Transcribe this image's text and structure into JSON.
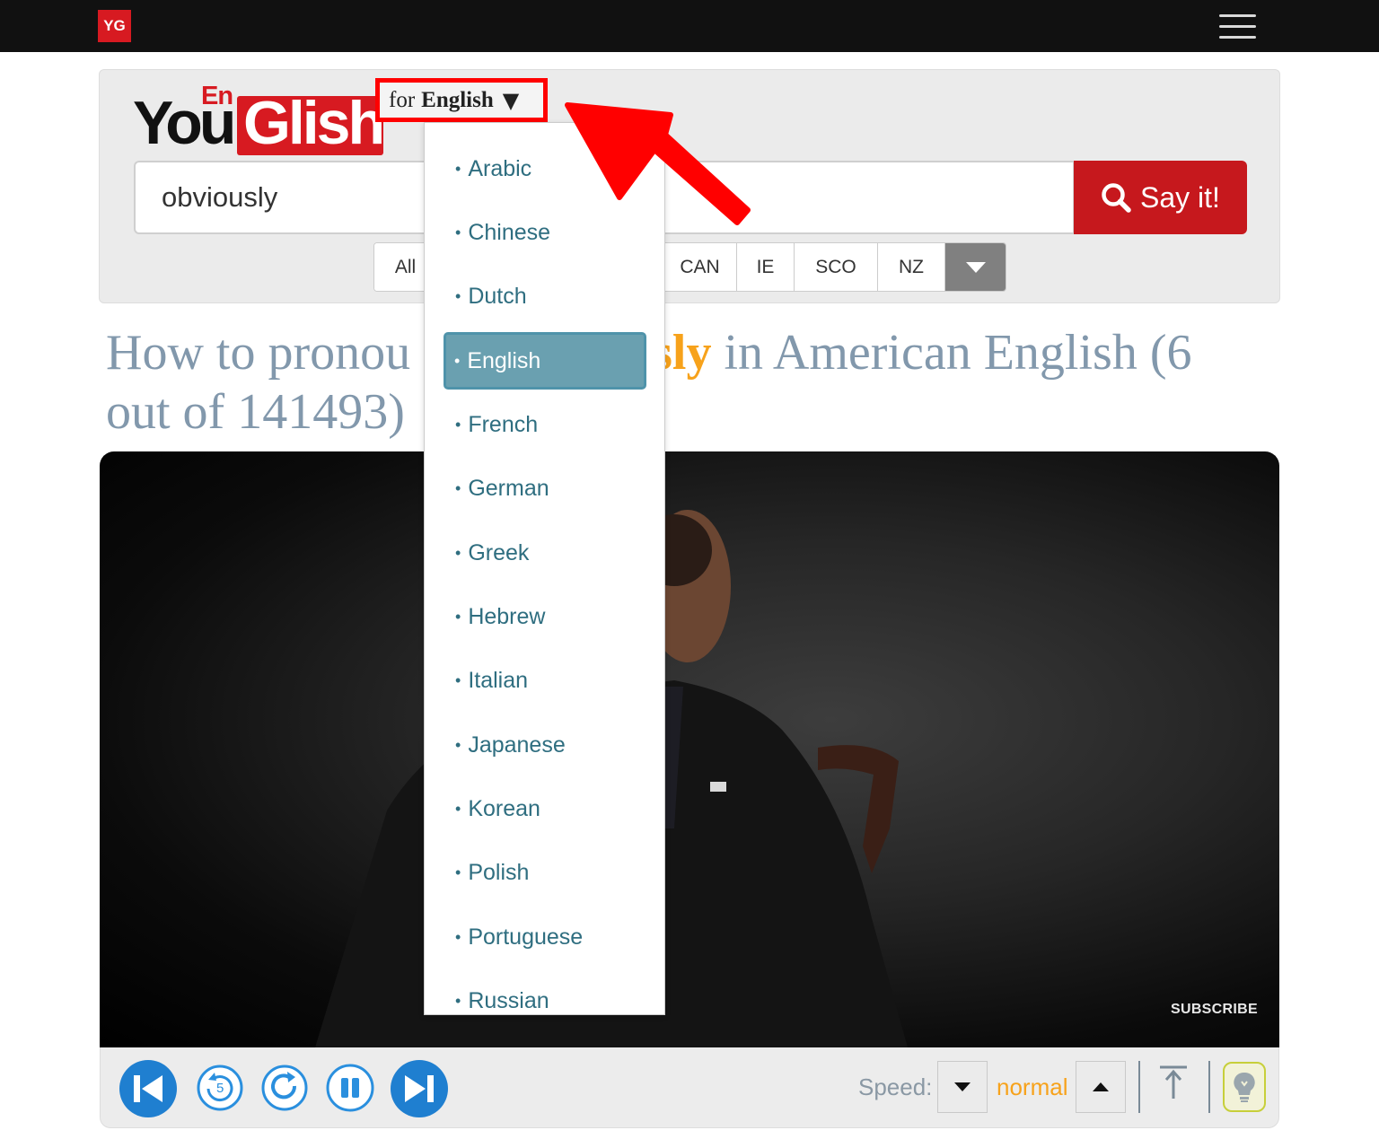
{
  "topbar": {
    "logo_text": "YG",
    "menu_icon": "hamburger-menu-icon"
  },
  "brand": {
    "you": "You",
    "glish": "Glish",
    "en": "En"
  },
  "language_selector": {
    "prefix": "for",
    "language": "English",
    "caret": "▼"
  },
  "search": {
    "value": "obviously",
    "button_label": "Say it!",
    "button_icon": "search-icon"
  },
  "accents": [
    "All",
    "CAN",
    "IE",
    "SCO",
    "NZ"
  ],
  "heading": {
    "before": "How to pronou",
    "word_fragment": "sly",
    "after": " in American English (6",
    "line2": "out of 141493)"
  },
  "dropdown": {
    "items": [
      "Arabic",
      "Chinese",
      "Dutch",
      "English",
      "French",
      "German",
      "Greek",
      "Hebrew",
      "Italian",
      "Japanese",
      "Korean",
      "Polish",
      "Portuguese",
      "Russian"
    ],
    "selected": "English"
  },
  "video": {
    "subscribe_label": "SUBSCRIBE"
  },
  "controls": {
    "buttons": [
      "previous-icon",
      "replay-5-icon",
      "repeat-icon",
      "pause-icon",
      "next-icon"
    ],
    "speed_label": "Speed:",
    "speed_value": "normal"
  },
  "colors": {
    "brand_red": "#d71a21",
    "accent_orange": "#f7a21b",
    "link_teal": "#2f6e80",
    "annotation_red": "#ff0000"
  }
}
